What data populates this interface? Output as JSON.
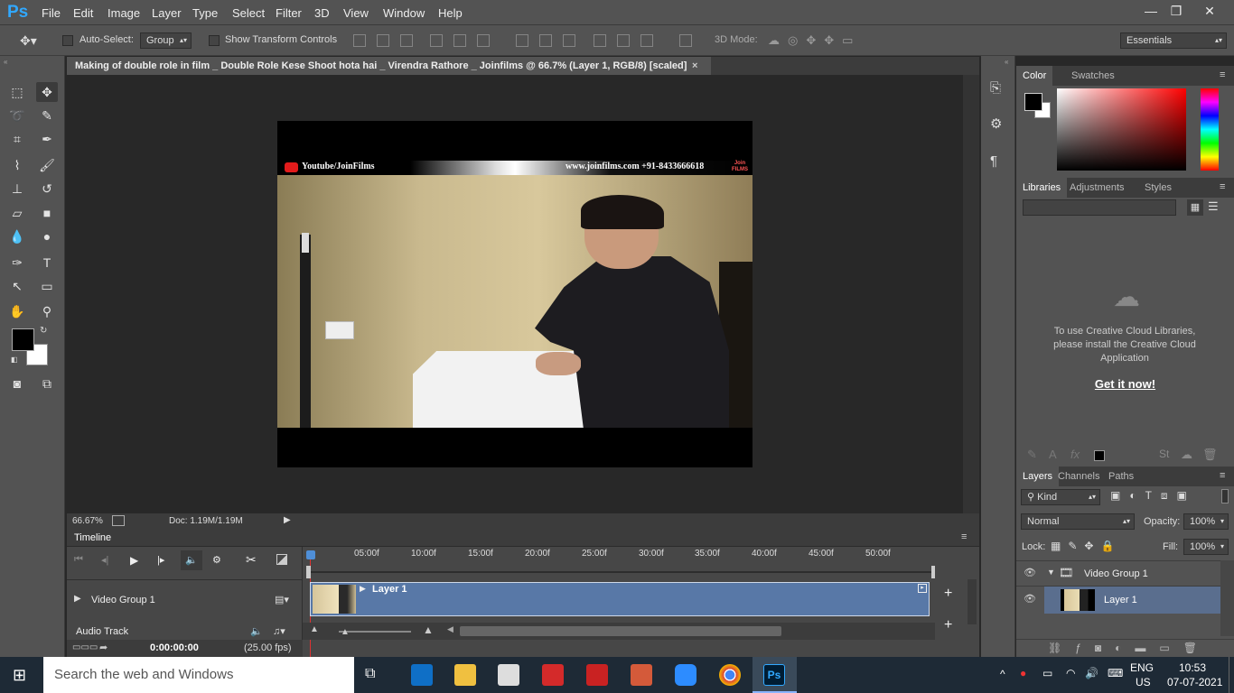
{
  "app": {
    "logo": "Ps"
  },
  "menu": [
    "File",
    "Edit",
    "Image",
    "Layer",
    "Type",
    "Select",
    "Filter",
    "3D",
    "View",
    "Window",
    "Help"
  ],
  "window_controls": {
    "minimize": "—",
    "maximize": "❐",
    "close": "✕"
  },
  "options": {
    "auto_select_label": "Auto-Select:",
    "auto_select_value": "Group",
    "show_transform_label": "Show Transform Controls",
    "mode_3d_label": "3D Mode:",
    "workspace": "Essentials"
  },
  "document": {
    "tab_title": "Making of double role in film _ Double Role Kese Shoot hota hai _ Virendra Rathore _ Joinfilms @ 66.7% (Layer 1, RGB/8) [scaled]",
    "tab_close": "×",
    "zoom": "66.67%",
    "doc_size": "Doc: 1.19M/1.19M",
    "banner_left": "Youtube/JoinFilms",
    "banner_right": "www.joinfilms.com  +91-8433666618",
    "banner_logo": "Join FILMS"
  },
  "timeline": {
    "title": "Timeline",
    "ticks": [
      "05:00f",
      "10:00f",
      "15:00f",
      "20:00f",
      "25:00f",
      "30:00f",
      "35:00f",
      "40:00f",
      "45:00f",
      "50:00f"
    ],
    "video_group": "Video Group 1",
    "audio_track": "Audio Track",
    "clip_label": "Layer 1",
    "timecode": "0:00:00:00",
    "fps": "(25.00 fps)"
  },
  "color_panel": {
    "tabs": [
      "Color",
      "Swatches"
    ],
    "foreground": "#000000",
    "background": "#ffffff"
  },
  "libraries_panel": {
    "tabs": [
      "Libraries",
      "Adjustments",
      "Styles"
    ],
    "message": "To use Creative Cloud Libraries, please install the Creative Cloud Application",
    "link": "Get it now!"
  },
  "layers_panel": {
    "tabs": [
      "Layers",
      "Channels",
      "Paths"
    ],
    "filter_kind": "Kind",
    "blend_mode": "Normal",
    "opacity_label": "Opacity:",
    "opacity": "100%",
    "lock_label": "Lock:",
    "fill_label": "Fill:",
    "fill": "100%",
    "layers": [
      {
        "name": "Video Group 1",
        "type": "group"
      },
      {
        "name": "Layer 1",
        "type": "layer"
      }
    ]
  },
  "taskbar": {
    "search_placeholder": "Search the web and Windows",
    "lang": "ENG",
    "region": "US",
    "time": "10:53",
    "date": "07-07-2021"
  },
  "colors": {
    "accent": "#31a8ff",
    "clip": "#5878a7",
    "panel": "#535353",
    "dark": "#282828"
  }
}
